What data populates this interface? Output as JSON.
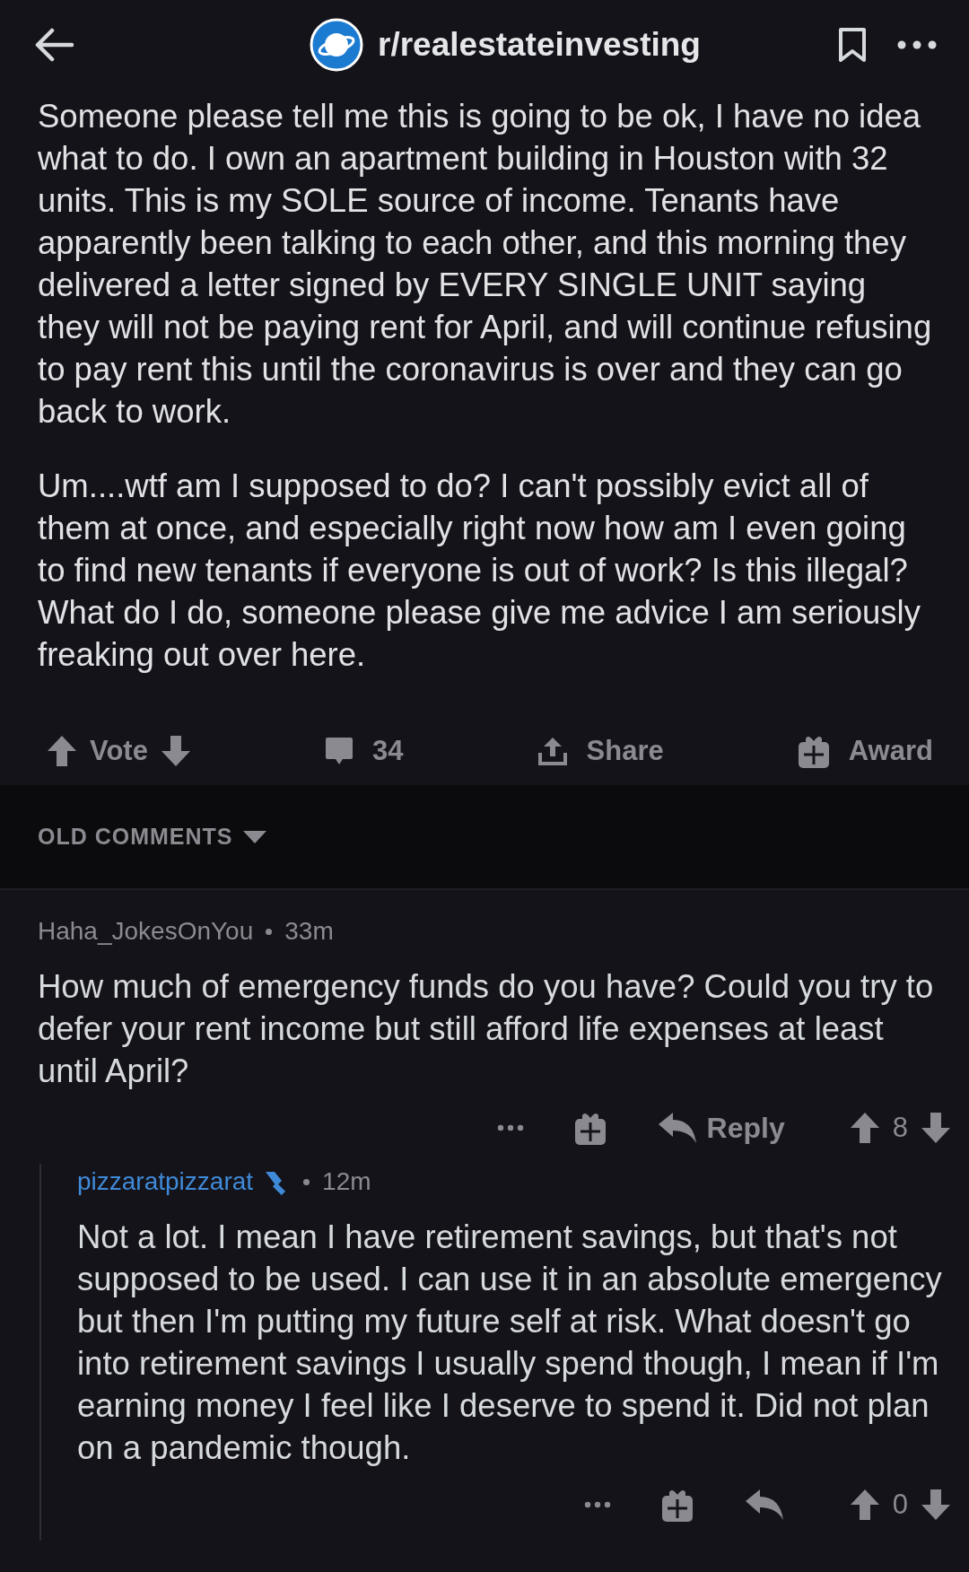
{
  "header": {
    "subreddit": "r/realestateinvesting"
  },
  "post": {
    "paragraphs": [
      "Someone please tell me this is going to be ok, I have no idea what to do. I own an apartment building in Houston with 32 units. This is my SOLE source of income. Tenants have apparently been talking to each other, and this morning they delivered a letter signed by EVERY SINGLE UNIT saying they will not be paying rent for April, and will continue refusing to pay rent this until the coronavirus is over and they can go back to work.",
      "Um....wtf am I supposed to do? I can't possibly evict all of them at once, and especially right now how am I even going to find new tenants if everyone is out of work? Is this illegal? What do I do, someone please give me advice I am seriously freaking out over here."
    ]
  },
  "post_actions": {
    "vote_label": "Vote",
    "comment_count": "34",
    "share_label": "Share",
    "award_label": "Award"
  },
  "comment_sort": {
    "label": "OLD COMMENTS"
  },
  "comments": [
    {
      "author": "Haha_JokesOnYou",
      "op": false,
      "time": "33m",
      "body": "How much of emergency funds do you have? Could you try to defer your rent income but still afford life expenses at least until April?",
      "reply_label": "Reply",
      "score": "8",
      "children": [
        {
          "author": "pizzaratpizzarat",
          "op": true,
          "time": "12m",
          "body": "Not a lot. I mean I have retirement savings, but that's not supposed to be used. I can use it in an absolute emergency but then I'm putting my future self at risk. What doesn't go into retirement savings I usually spend though, I mean if I'm earning money I feel like I deserve to spend it. Did not plan on a pandemic though.",
          "score": "0"
        }
      ]
    }
  ]
}
